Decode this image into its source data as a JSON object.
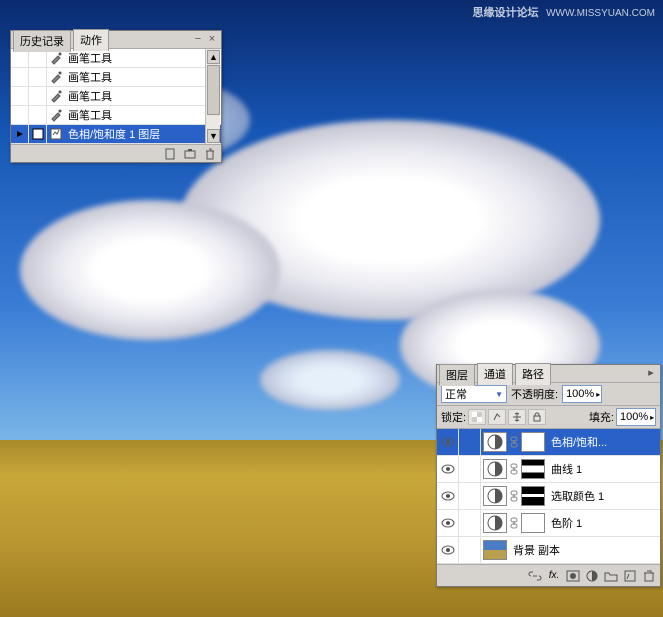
{
  "watermark": {
    "text": "思缘设计论坛",
    "url": "WWW.MISSYUAN.COM"
  },
  "history_panel": {
    "tabs": [
      {
        "label": "历史记录",
        "active": true
      },
      {
        "label": "动作",
        "active": false
      }
    ],
    "items": [
      {
        "label": "画笔工具",
        "icon": "brush",
        "selected": false
      },
      {
        "label": "画笔工具",
        "icon": "brush",
        "selected": false
      },
      {
        "label": "画笔工具",
        "icon": "brush",
        "selected": false
      },
      {
        "label": "画笔工具",
        "icon": "brush",
        "selected": false
      },
      {
        "label": "色相/饱和度 1 图层",
        "icon": "adjustment",
        "selected": true
      }
    ]
  },
  "layers_panel": {
    "tabs": [
      {
        "label": "图层",
        "active": true
      },
      {
        "label": "通道",
        "active": false
      },
      {
        "label": "路径",
        "active": false
      }
    ],
    "blend_mode": "正常",
    "opacity_label": "不透明度:",
    "opacity_value": "100%",
    "lock_label": "锁定:",
    "fill_label": "填充:",
    "fill_value": "100%",
    "layers": [
      {
        "label": "色相/饱和...",
        "visible": true,
        "thumb": "adj",
        "mask": "white",
        "selected": true
      },
      {
        "label": "曲线 1",
        "visible": true,
        "thumb": "adj",
        "mask": "curves",
        "selected": false
      },
      {
        "label": "选取颜色 1",
        "visible": true,
        "thumb": "adj",
        "mask": "sel",
        "selected": false
      },
      {
        "label": "色阶 1",
        "visible": true,
        "thumb": "adj",
        "mask": "white",
        "selected": false
      },
      {
        "label": "背景 副本",
        "visible": true,
        "thumb": "img",
        "mask": null,
        "selected": false
      }
    ]
  }
}
